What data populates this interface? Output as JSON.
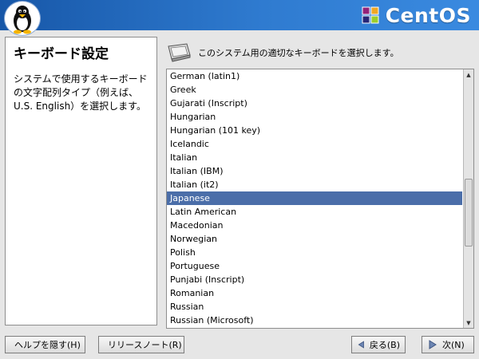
{
  "header": {
    "brand_text": "CentOS",
    "logo_icon": "tux-penguin-icon",
    "brand_icon": "centos-logo-icon"
  },
  "help_panel": {
    "title": "キーボード設定",
    "body": "システムで使用するキーボードの文字配列タイプ（例えば、U.S. English）を選択します。"
  },
  "prompt": {
    "icon": "keyboard-key-icon",
    "text": "このシステム用の適切なキーボードを選択します。"
  },
  "keyboard_list": {
    "items": [
      "German (latin1)",
      "Greek",
      "Gujarati (Inscript)",
      "Hungarian",
      "Hungarian (101 key)",
      "Icelandic",
      "Italian",
      "Italian (IBM)",
      "Italian (it2)",
      "Japanese",
      "Latin American",
      "Macedonian",
      "Norwegian",
      "Polish",
      "Portuguese",
      "Punjabi (Inscript)",
      "Romanian",
      "Russian",
      "Russian (Microsoft)"
    ],
    "selected": "Japanese"
  },
  "buttons": {
    "hide_help": "ヘルプを隠す(H)",
    "release_notes": "リリースノート(R)",
    "back": "戻る(B)",
    "next": "次(N)"
  },
  "colors": {
    "header_blue": "#2f7bd0",
    "selection": "#4b6ea9"
  }
}
